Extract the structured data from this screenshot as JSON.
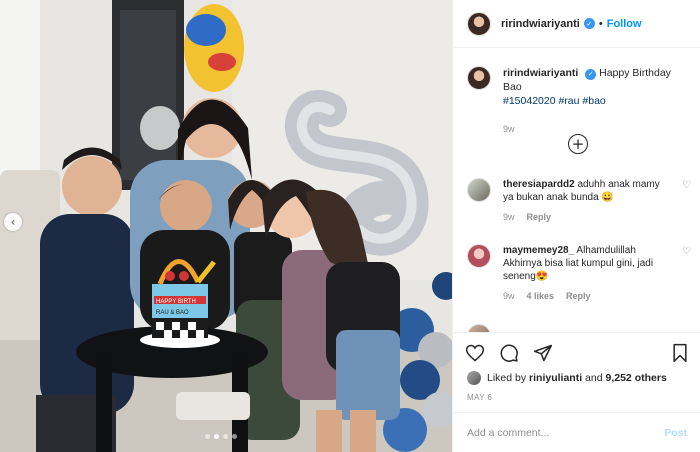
{
  "post": {
    "username": "ririndwiariyanti",
    "follow_label": "Follow",
    "separator": "•",
    "caption_text": "Happy Birthday Bao",
    "hashtags": "#15042020 #rau #bao",
    "caption_age": "9w",
    "load_more_symbol": "+",
    "cake_text_top": "HAPPY BIRTH",
    "cake_text_bottom": "RAU & BAO"
  },
  "comments": [
    {
      "username": "theresiapardd2",
      "text": "aduhh anak mamy ya bukan anak bunda 😀",
      "age": "9w",
      "reply_label": "Reply",
      "likes": ""
    },
    {
      "username": "maymemey28_",
      "text": "Alhamdulillah Akhirnya bisa liat kumpul gini, jadi seneng😍",
      "age": "9w",
      "likes": "4 likes",
      "reply_label": "Reply"
    }
  ],
  "actions": {
    "liked_by_prefix": "Liked by",
    "liked_by_user": "riniyulianti",
    "liked_by_and": "and",
    "liked_by_others": "9,252 others",
    "date": "MAY 6",
    "add_comment_placeholder": "Add a comment...",
    "post_label": "Post"
  },
  "icons": {
    "nav_prev": "‹",
    "verified": "✓",
    "heart_small": "♡"
  },
  "colors": {
    "link_blue": "#0095f6",
    "verified_blue": "#3897f0",
    "hashtag": "#00376b",
    "muted": "#8e8e8e",
    "post_disabled": "#b2dffc"
  }
}
